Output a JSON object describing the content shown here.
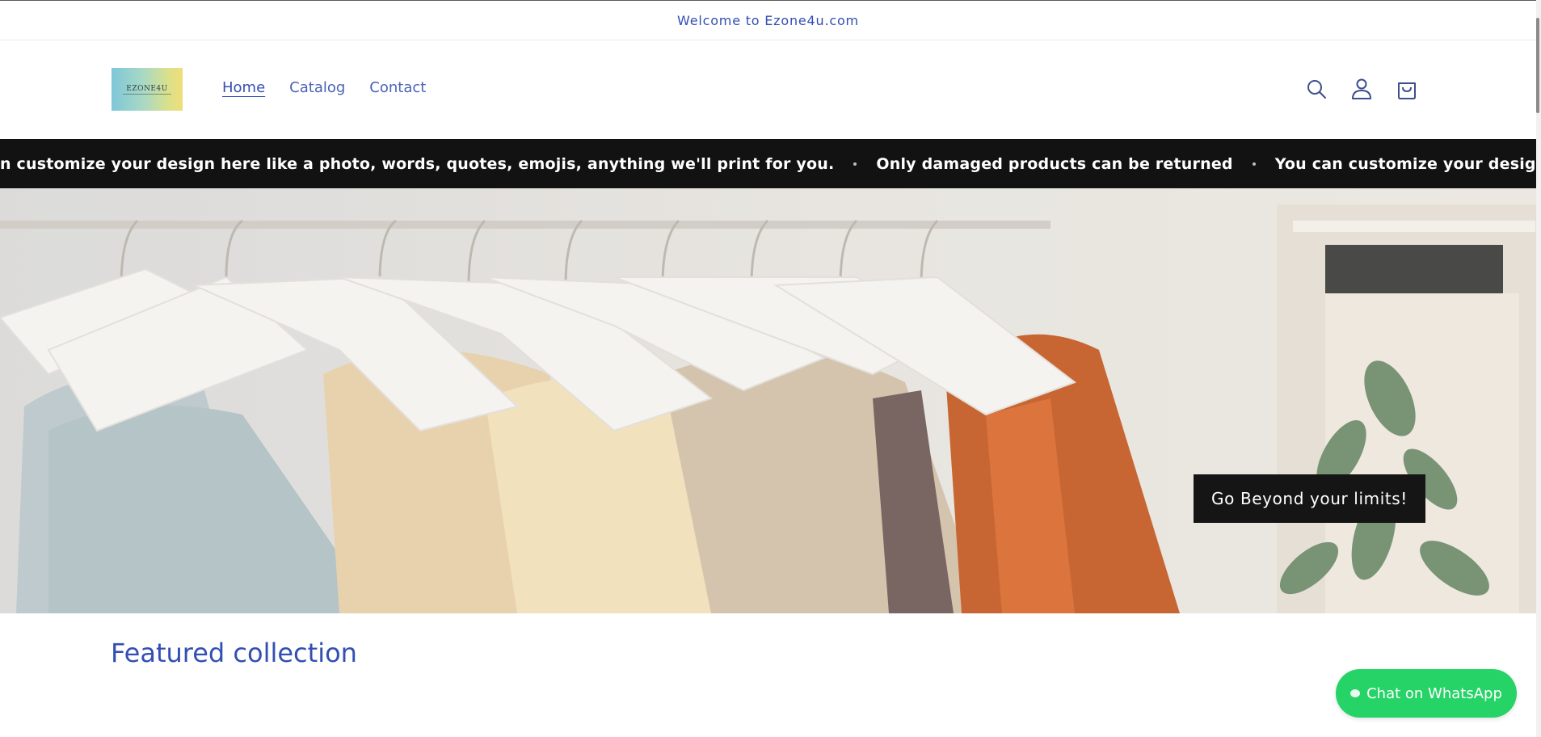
{
  "announcement": {
    "text": "Welcome to Ezone4u.com"
  },
  "header": {
    "logo_text": "EZONE4U",
    "nav": [
      {
        "label": "Home",
        "active": true
      },
      {
        "label": "Catalog",
        "active": false
      },
      {
        "label": "Contact",
        "active": false
      }
    ],
    "icons": [
      "search-icon",
      "account-icon",
      "cart-icon"
    ]
  },
  "marquee": {
    "items": [
      "n customize your design here like a photo, words, quotes, emojis, anything we'll print for you.",
      "Only damaged products can be returned",
      "You can customize your design here like a photo, words, quotes, emojis, anything we'll print for you."
    ]
  },
  "hero": {
    "button_label": "Go Beyond your limits!"
  },
  "featured": {
    "title": "Featured collection"
  },
  "whatsapp": {
    "label": "Chat on WhatsApp",
    "color": "#25d366"
  },
  "colors": {
    "accent": "#334fb4",
    "dark_bar": "#121212"
  }
}
